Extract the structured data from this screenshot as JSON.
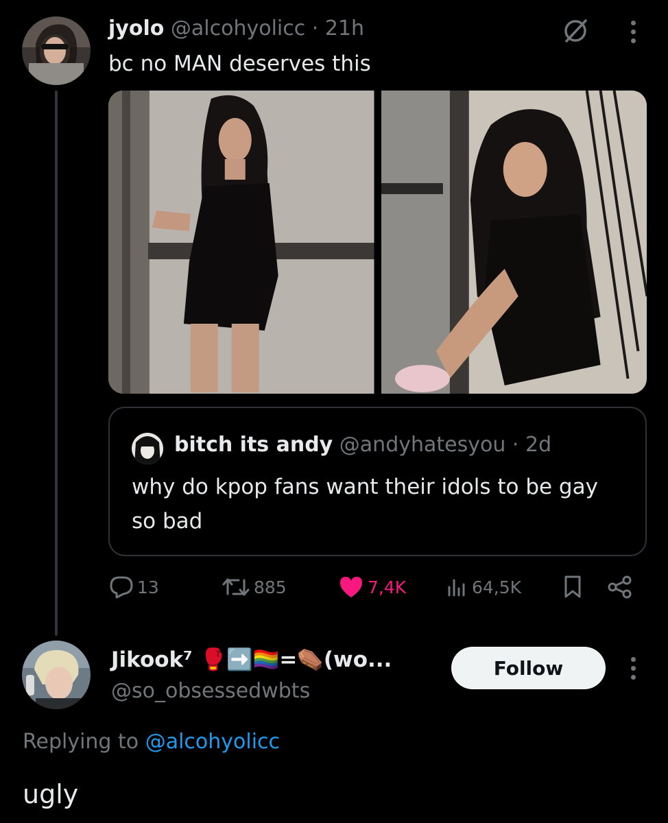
{
  "tweet": {
    "display_name": "jyolo",
    "handle": "@alcohyolicc",
    "time": "21h",
    "text": "bc no MAN deserves this"
  },
  "quoted_tweet": {
    "display_name": "bitch its andy",
    "handle": "@andyhatesyou",
    "time": "2d",
    "text": "why do kpop fans want their idols to be gay so bad"
  },
  "actions": {
    "replies": "13",
    "retweets": "885",
    "likes": "7,4K",
    "views": "64,5K"
  },
  "reply": {
    "display_name": "Jikook⁷ 🥊➡️🏳️‍🌈=⚰️(wo...",
    "handle": "@so_obsessedwbts",
    "follow_label": "Follow",
    "replying_prefix": "Replying to",
    "replying_to": "@alcohyolicc",
    "text": "ugly"
  },
  "colors": {
    "background": "#000000",
    "muted": "#71767b",
    "link": "#1d9bf0",
    "like": "#f91880"
  }
}
